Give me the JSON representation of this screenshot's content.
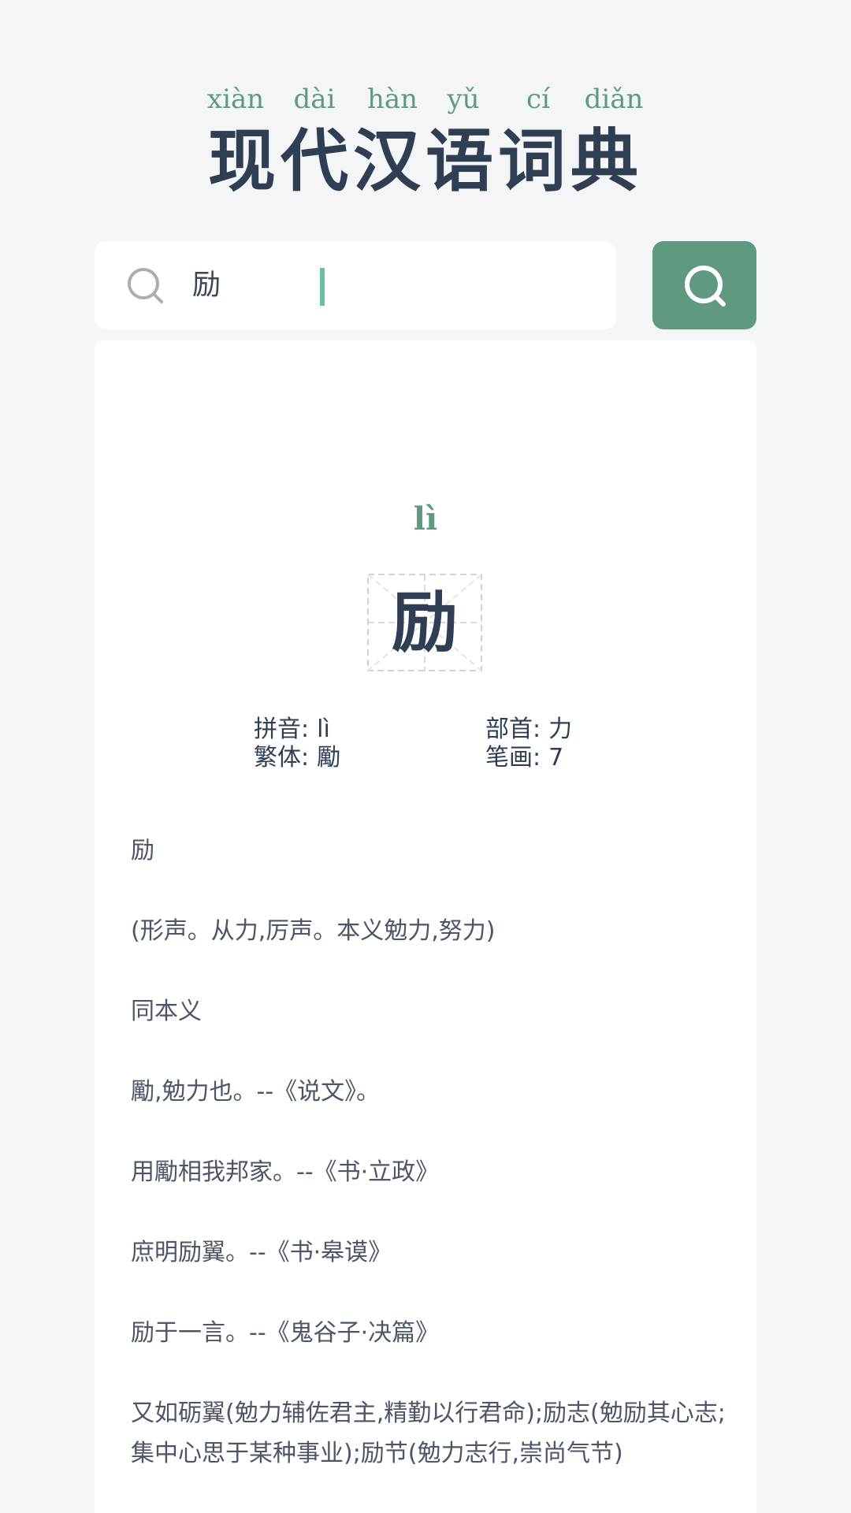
{
  "header": {
    "pinyin": [
      "xiàn",
      "dài",
      "hàn",
      "yǔ",
      "cí",
      "diǎn"
    ],
    "title": "现代汉语词典"
  },
  "search": {
    "query": "励"
  },
  "result": {
    "pinyin_display": "lì",
    "character": "励",
    "info": {
      "pinyin_label": "拼音:",
      "pinyin_value": "lì",
      "radical_label": "部首:",
      "radical_value": "力",
      "traditional_label": "繁体:",
      "traditional_value": "勵",
      "strokes_label": "笔画:",
      "strokes_value": "7"
    },
    "definition": [
      "励",
      " (形声。从力,厉声。本义勉力,努力)",
      " 同本义",
      " 勵,勉力也。--《说文》。",
      " 用勵相我邦家。--《书·立政》",
      " 庶明励翼。--《书·皋谟》",
      " 励于一言。--《鬼谷子·决篇》",
      " 又如砺翼(勉力辅佐君主,精勤以行君命);励志(勉励其心志;集中心思于某种事业);励节(勉力志行,崇尚气节)"
    ]
  }
}
